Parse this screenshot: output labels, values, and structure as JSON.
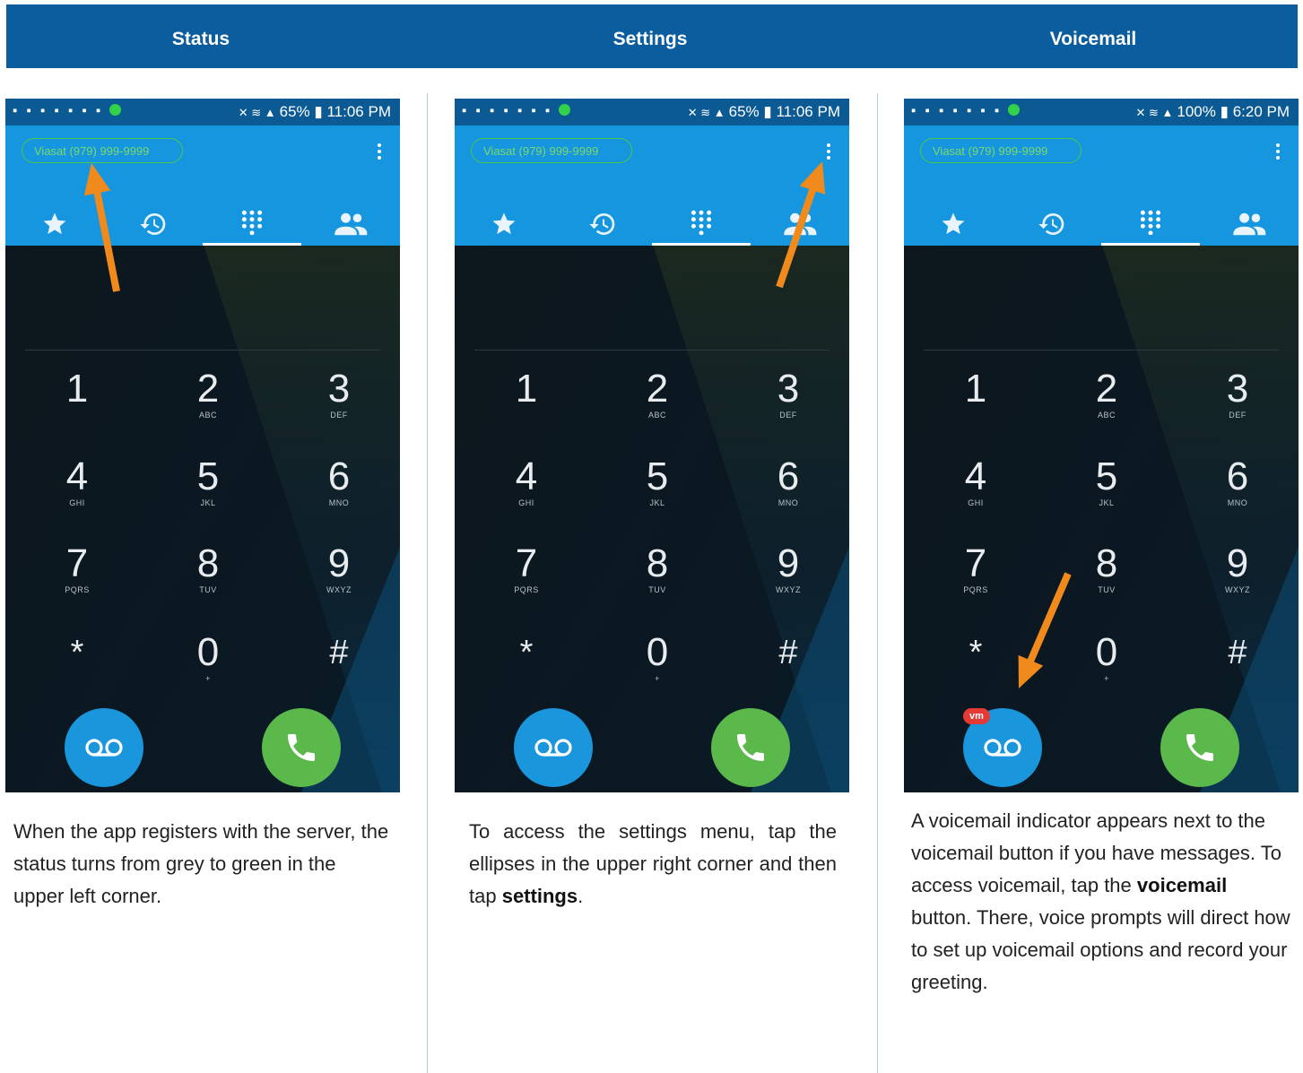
{
  "header": {
    "col1": "Status",
    "col2": "Settings",
    "col3": "Voicemail"
  },
  "colors": {
    "header_bg": "#0b5d9e",
    "appbar": "#1596de",
    "voicemail_button": "#1a96dc",
    "call_button": "#5ab94a",
    "status_green": "#4cc84e",
    "arrow": "#f18a1d",
    "badge": "#e53935"
  },
  "phones": [
    {
      "time": "11:06 PM",
      "battery": "65%",
      "account_status": "Viasat (979) 999-9999"
    },
    {
      "time": "11:06 PM",
      "battery": "65%",
      "account_status": "Viasat (979) 999-9999"
    },
    {
      "time": "6:20 PM",
      "battery": "100%",
      "account_status": "Viasat (979) 999-9999",
      "voicemail_badge": "vm"
    }
  ],
  "tabs": [
    "favorites-star-icon",
    "history-icon",
    "dialpad-icon",
    "contacts-icon"
  ],
  "dialpad": [
    {
      "digit": "1",
      "letters": ""
    },
    {
      "digit": "2",
      "letters": "ABC"
    },
    {
      "digit": "3",
      "letters": "DEF"
    },
    {
      "digit": "4",
      "letters": "GHI"
    },
    {
      "digit": "5",
      "letters": "JKL"
    },
    {
      "digit": "6",
      "letters": "MNO"
    },
    {
      "digit": "7",
      "letters": "PQRS"
    },
    {
      "digit": "8",
      "letters": "TUV"
    },
    {
      "digit": "9",
      "letters": "WXYZ"
    },
    {
      "digit": "*",
      "letters": ""
    },
    {
      "digit": "0",
      "letters": "+"
    },
    {
      "digit": "#",
      "letters": ""
    }
  ],
  "captions": {
    "status": "When the app registers with the server, the status turns from grey to green in the upper left corner.",
    "settings_pre": "To access the settings menu, tap the ellipses in the upper right corner and then tap ",
    "settings_bold": "settings",
    "settings_post": ".",
    "voicemail_pre": "A voicemail indicator appears next to the voicemail button if you have messages. To access voicemail, tap the ",
    "voicemail_bold": "voicemail",
    "voicemail_post": " button. There, voice prompts will direct how to set up voicemail options and record your greeting."
  }
}
